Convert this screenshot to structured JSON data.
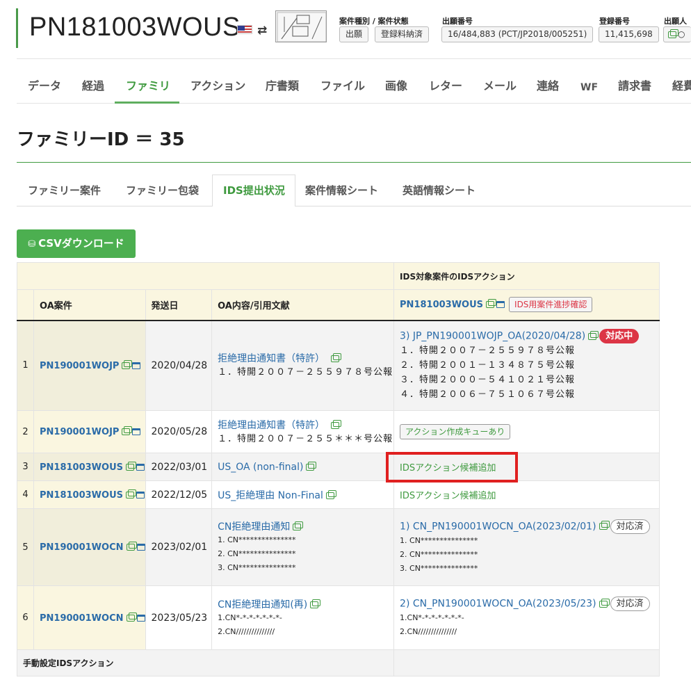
{
  "header": {
    "case_number": "PN181003WOUS",
    "flag_icon": "us-flag-icon",
    "meta": [
      {
        "label": "案件種別 / 案件状態",
        "values": [
          "出願",
          "登録料納済"
        ]
      },
      {
        "label": "出願番号",
        "values": [
          "16/484,883 (PCT/JP2018/005251)"
        ]
      },
      {
        "label": "登録番号",
        "values": [
          "11,415,698"
        ]
      },
      {
        "label": "出願人",
        "values": [
          "○"
        ]
      }
    ]
  },
  "main_tabs": [
    "データ",
    "経過",
    "ファミリ",
    "アクション",
    "庁書類",
    "ファイル",
    "画像",
    "レター",
    "メール",
    "連絡",
    "WF",
    "請求書",
    "経費"
  ],
  "main_tab_active": "ファミリ",
  "family_title": "ファミリーID ＝ 35",
  "sub_tabs": [
    "ファミリー案件",
    "ファミリー包袋",
    "IDS提出状況",
    "案件情報シート",
    "英語情報シート"
  ],
  "sub_tab_active": "IDS提出状況",
  "csv_button": "CSVダウンロード",
  "table": {
    "group_header": "IDS対象案件のIDSアクション",
    "columns": [
      "OA案件",
      "発送日",
      "OA内容/引用文献"
    ],
    "ids_case": "PN181003WOUS",
    "ids_progress_button": "IDS用案件進捗確認",
    "rows": [
      {
        "no": "1",
        "case": "PN190001WOJP",
        "date": "2020/04/28",
        "doc_title": "拒絶理由通知書（特許）",
        "doc_items": [
          "１．特開２００７－２５５９７８号公報"
        ],
        "ids_title": "3) JP_PN190001WOJP_OA(2020/04/28)",
        "ids_badge": "対応中",
        "ids_items": [
          "１．特開２００７－２５５９７８号公報",
          "２．特開２００１－１３４８７５号公報",
          "３．特開２０００－５４１０２１号公報",
          "４．特開２００６－７５１０６７号公報"
        ]
      },
      {
        "no": "2",
        "case": "PN190001WOJP",
        "date": "2020/05/28",
        "doc_title": "拒絶理由通知書（特許）",
        "doc_items": [
          "１．特開２００７－２５５＊＊＊号公報"
        ],
        "ids_queue": "アクション作成キューあり"
      },
      {
        "no": "3",
        "case": "PN181003WOUS",
        "date": "2022/03/01",
        "doc_title": "US_OA (non-final)",
        "ids_link": "IDSアクション候補追加"
      },
      {
        "no": "4",
        "case": "PN181003WOUS",
        "date": "2022/12/05",
        "doc_title": "US_拒絶理由 Non-Final",
        "ids_link": "IDSアクション候補追加"
      },
      {
        "no": "5",
        "case": "PN190001WOCN",
        "date": "2023/02/01",
        "doc_title": "CN拒絶理由通知",
        "doc_items": [
          "1. CN***************",
          "2. CN***************",
          "3. CN***************"
        ],
        "ids_title": "1) CN_PN190001WOCN_OA(2023/02/01)",
        "ids_badge": "対応済",
        "ids_items": [
          "1. CN***************",
          "2. CN***************",
          "3. CN***************"
        ]
      },
      {
        "no": "6",
        "case": "PN190001WOCN",
        "date": "2023/05/23",
        "doc_title": "CN拒絶理由通知(再)",
        "doc_items": [
          "1.CN*-*-*-*-*-*-*-",
          "2.CN///////////////"
        ],
        "ids_title": "2) CN_PN190001WOCN_OA(2023/05/23)",
        "ids_badge": "対応済",
        "ids_items": [
          "1.CN*-*-*-*-*-*-*-",
          "2.CN///////////////"
        ]
      }
    ],
    "manual_label": "手動設定IDSアクション"
  }
}
